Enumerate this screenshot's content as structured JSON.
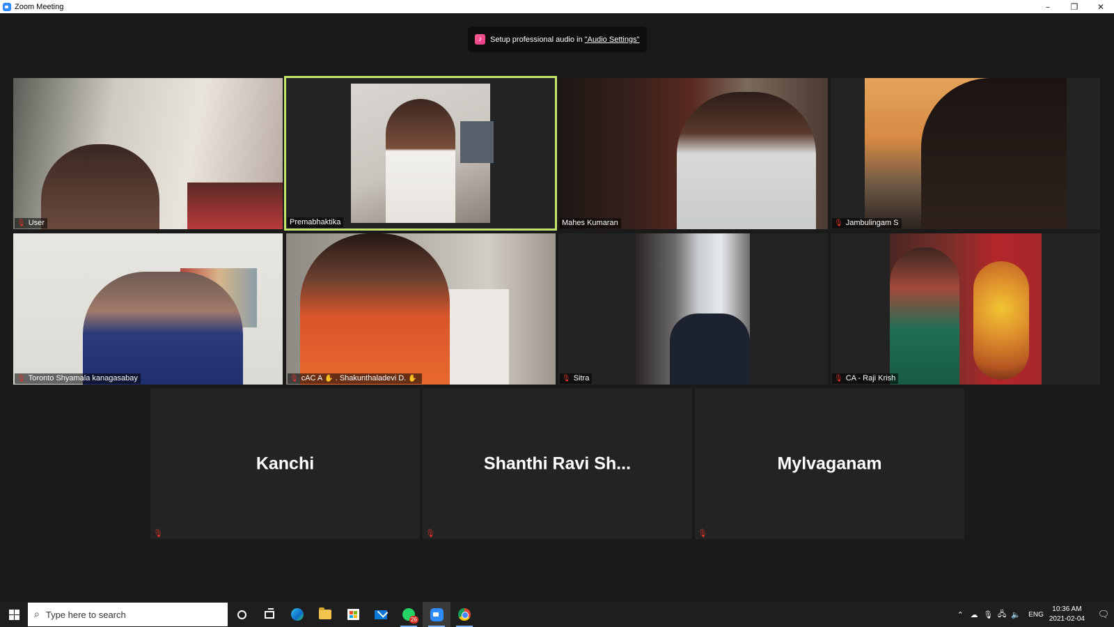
{
  "window": {
    "title": "Zoom Meeting",
    "minimize": "–",
    "restore": "❐",
    "close": "✕"
  },
  "notification": {
    "prefix": "Setup professional audio in ",
    "link": "\"Audio Settings\"",
    "icon": "music-note-icon"
  },
  "participants": [
    {
      "name": "User",
      "muted": true
    },
    {
      "name": "Premabhaktika",
      "muted": false,
      "active_speaker": true
    },
    {
      "name": "Mahes Kumaran",
      "muted": false
    },
    {
      "name": "Jambulingam S",
      "muted": true
    },
    {
      "name": "Toronto  Shyamala  kanagasabay",
      "muted": true
    },
    {
      "name_prefix": "cAC A",
      "name": ". Shakunthaladevi D.",
      "muted": true,
      "hand_icon": "✋"
    },
    {
      "name": "Sitra",
      "muted": true
    },
    {
      "name": "CA - Raji Krish",
      "muted": true
    },
    {
      "name": "Kanchi",
      "muted": true,
      "video_off": true
    },
    {
      "name": "Shanthi Ravi Sh...",
      "muted": true,
      "video_off": true
    },
    {
      "name": "Mylvaganam",
      "muted": true,
      "video_off": true
    }
  ],
  "taskbar": {
    "search_placeholder": "Type here to search",
    "whatsapp_badge": "26",
    "language": "ENG",
    "time": "10:36 AM",
    "date": "2021-02-04",
    "tray_icons": [
      "chevron-up-icon",
      "onedrive-icon",
      "microphone-icon",
      "network-icon",
      "speaker-icon"
    ]
  },
  "colors": {
    "active_border": "#c3e36d",
    "muted_red": "#e5352b",
    "tile_bg": "#232323",
    "zoom_blue": "#2d8cff"
  }
}
